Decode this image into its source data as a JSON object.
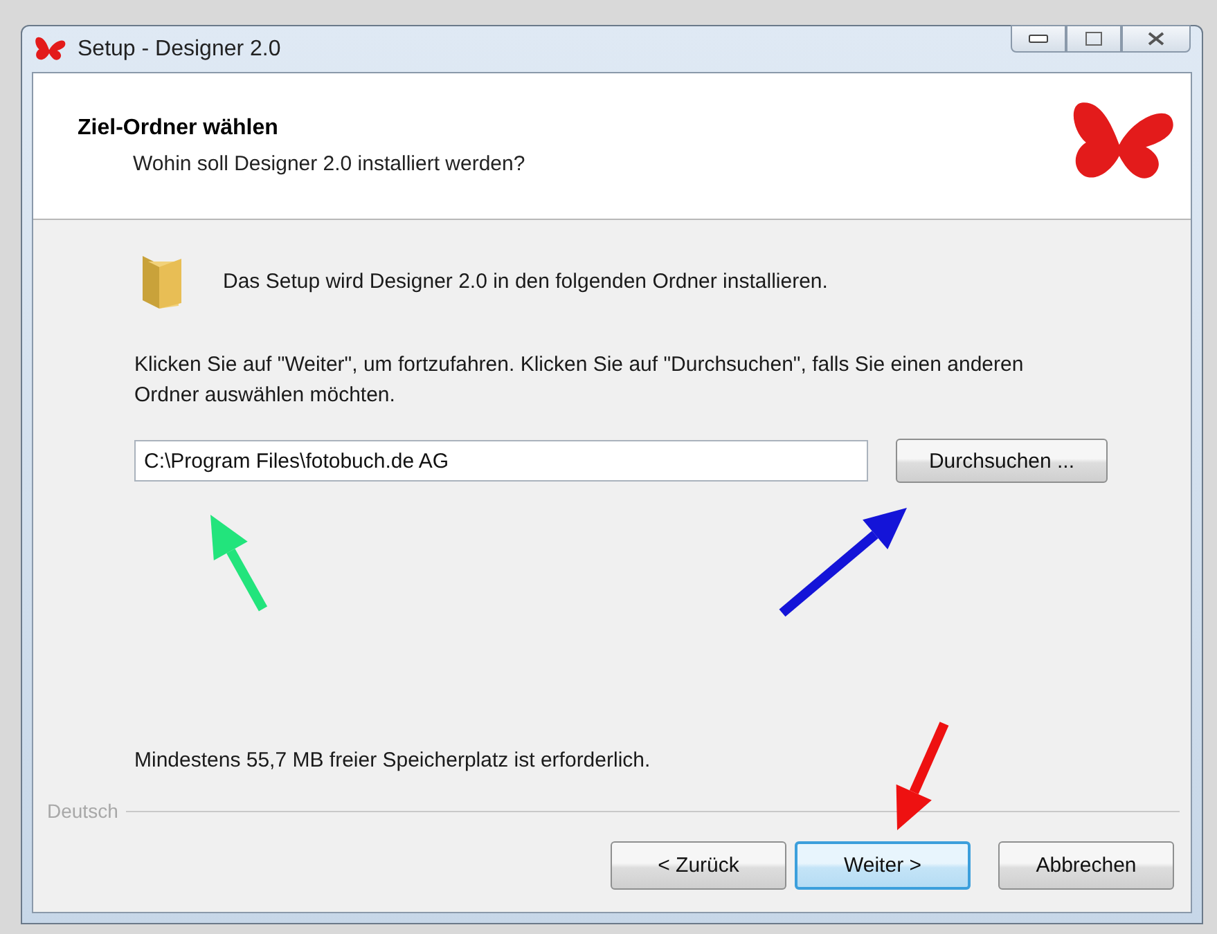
{
  "window": {
    "title": "Setup - Designer 2.0"
  },
  "header": {
    "title": "Ziel-Ordner wählen",
    "subtitle": "Wohin soll Designer 2.0 installiert werden?"
  },
  "body": {
    "intro": "Das Setup wird Designer 2.0 in den folgenden Ordner installieren.",
    "instruction": "Klicken Sie auf \"Weiter\", um fortzufahren. Klicken Sie auf \"Durchsuchen\", falls Sie einen anderen Ordner auswählen möchten.",
    "path_field": {
      "value": "C:\\Program Files\\fotobuch.de AG"
    },
    "browse_button": "Durchsuchen ...",
    "space_note": "Mindestens 55,7 MB freier Speicherplatz ist erforderlich."
  },
  "language_label": "Deutsch",
  "buttons": [
    {
      "label": "< Zurück",
      "default": false
    },
    {
      "label": "Weiter >",
      "default": true
    },
    {
      "label": "Abbrechen",
      "default": false
    }
  ],
  "annotations": [
    {
      "color": "#22e47c"
    },
    {
      "color": "#1414d8"
    },
    {
      "color": "#ee1111"
    }
  ]
}
